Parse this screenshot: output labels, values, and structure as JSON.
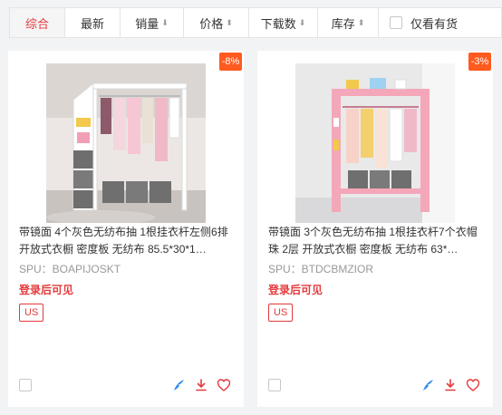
{
  "sort_bar": {
    "items": [
      {
        "label": "综合",
        "arrow": ""
      },
      {
        "label": "最新",
        "arrow": ""
      },
      {
        "label": "销量",
        "arrow": "⬇"
      },
      {
        "label": "价格",
        "arrow": "⬍"
      },
      {
        "label": "下载数",
        "arrow": "⬇"
      },
      {
        "label": "库存",
        "arrow": "⬍"
      }
    ],
    "active_index": 0,
    "in_stock_label": "仅看有货"
  },
  "products": [
    {
      "discount": "-8%",
      "title": "带镜面 4个灰色无纺布抽 1根挂衣杆左侧6排 开放式衣橱 密度板 无纺布 85.5*30*1…",
      "spu": "SPU：BOAPIJOSKT",
      "price_text": "登录后可见",
      "site": "US",
      "image": {
        "frame_color": "#ffffff",
        "accent": "grey"
      }
    },
    {
      "discount": "-3%",
      "title": "带镜面 3个灰色无纺布抽 1根挂衣杆7个衣帽珠 2层 开放式衣橱 密度板 无纺布 63*…",
      "spu": "SPU：BTDCBMZIOR",
      "price_text": "登录后可见",
      "site": "US",
      "image": {
        "frame_color": "#f4a7b9",
        "accent": "pink"
      }
    }
  ],
  "icons": {
    "feather": "feather-icon",
    "download": "download-icon",
    "favorite": "heart-icon"
  },
  "colors": {
    "brand_red": "#e4393c",
    "discount_orange": "#ff5a1f",
    "feather_blue": "#2d8cf0"
  }
}
